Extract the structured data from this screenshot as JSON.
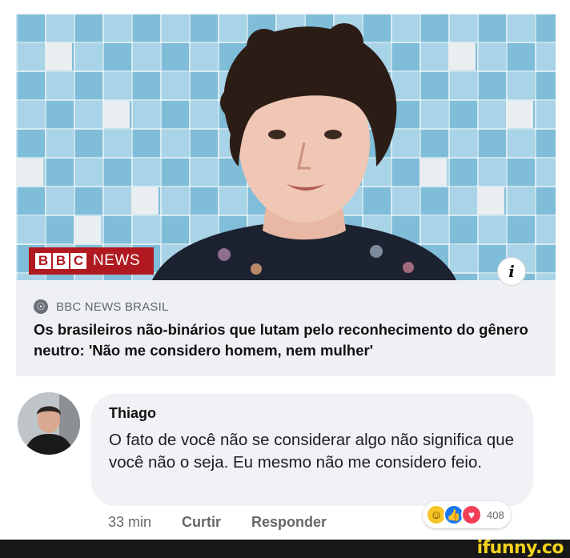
{
  "post": {
    "media_logo": {
      "blocks": [
        "B",
        "B",
        "C"
      ],
      "label": "NEWS"
    },
    "info_icon": "i",
    "source": {
      "icon": "globe-icon",
      "name": "BBC NEWS BRASIL"
    },
    "headline": "Os brasileiros não-binários que lutam pelo reconhecimento do gênero neutro: 'Não me considero homem, nem mulher'"
  },
  "comment": {
    "author": "Thiago",
    "text": "O fato de você não se considerar algo não significa que você não o seja. Eu mesmo não me considero feio.",
    "time": "33 min",
    "like_label": "Curtir",
    "reply_label": "Responder",
    "reactions": {
      "icons": [
        "haha-icon",
        "like-icon",
        "love-icon"
      ],
      "count": "408"
    }
  },
  "watermark": "ifunny.co",
  "colors": {
    "bbc_red": "#b0191f",
    "facebook_blue": "#1877f2",
    "watermark_yellow": "#f2d11b"
  }
}
